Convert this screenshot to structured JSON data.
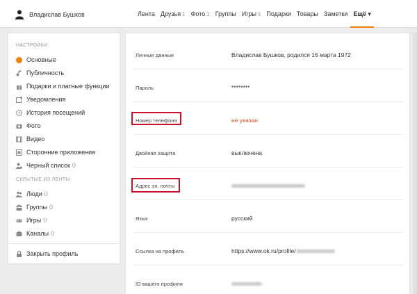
{
  "header": {
    "user_name": "Владислав Бушков",
    "nav": [
      {
        "label": "Лента",
        "count": ""
      },
      {
        "label": "Друзья",
        "count": "1"
      },
      {
        "label": "Фото",
        "count": "1"
      },
      {
        "label": "Группы",
        "count": ""
      },
      {
        "label": "Игры",
        "count": "5"
      },
      {
        "label": "Подарки",
        "count": ""
      },
      {
        "label": "Товары",
        "count": ""
      },
      {
        "label": "Заметки",
        "count": ""
      },
      {
        "label": "Ещё ▾",
        "count": ""
      }
    ]
  },
  "sidebar": {
    "settings_heading": "НАСТРОЙКИ",
    "settings_items": [
      {
        "label": "Основные",
        "icon": "gear-icon"
      },
      {
        "label": "Публичность",
        "icon": "key-icon"
      },
      {
        "label": "Подарки и платные функции",
        "icon": "gift-icon"
      },
      {
        "label": "Уведомления",
        "icon": "notification-icon"
      },
      {
        "label": "История посещений",
        "icon": "history-icon"
      },
      {
        "label": "Фото",
        "icon": "camera-icon"
      },
      {
        "label": "Видео",
        "icon": "video-icon"
      },
      {
        "label": "Сторонние приложения",
        "icon": "apps-icon"
      },
      {
        "label": "Черный список",
        "count": "0",
        "icon": "blocked-user-icon"
      }
    ],
    "hidden_heading": "СКРЫТЫЕ ИЗ ЛЕНТЫ",
    "hidden_items": [
      {
        "label": "Люди",
        "count": "0",
        "icon": "people-icon"
      },
      {
        "label": "Группы",
        "count": "0",
        "icon": "groups-icon"
      },
      {
        "label": "Игры",
        "count": "0",
        "icon": "gamepad-icon"
      },
      {
        "label": "Каналы",
        "count": "0",
        "icon": "channels-icon"
      }
    ],
    "close_profile": {
      "label": "Закрыть профиль",
      "icon": "lock-icon"
    }
  },
  "settings": [
    {
      "label": "Личные данные",
      "value": "Владислав Бушков, родился 16 марта 1972"
    },
    {
      "label": "Пароль",
      "value": "********"
    },
    {
      "label": "Номер телефона",
      "value": "не указан"
    },
    {
      "label": "Двойная защита",
      "value": "выключена"
    },
    {
      "label": "Адрес эл. почты",
      "value": ""
    },
    {
      "label": "Язык",
      "value": "русский"
    },
    {
      "label": "Ссылка на профиль",
      "value": "https://www.ok.ru/profile/"
    },
    {
      "label": "ID вашего профиля",
      "value": ""
    }
  ],
  "colors": {
    "accent": "#ee8208",
    "warn": "#d14a1e",
    "highlight_box": "#c8102e"
  }
}
